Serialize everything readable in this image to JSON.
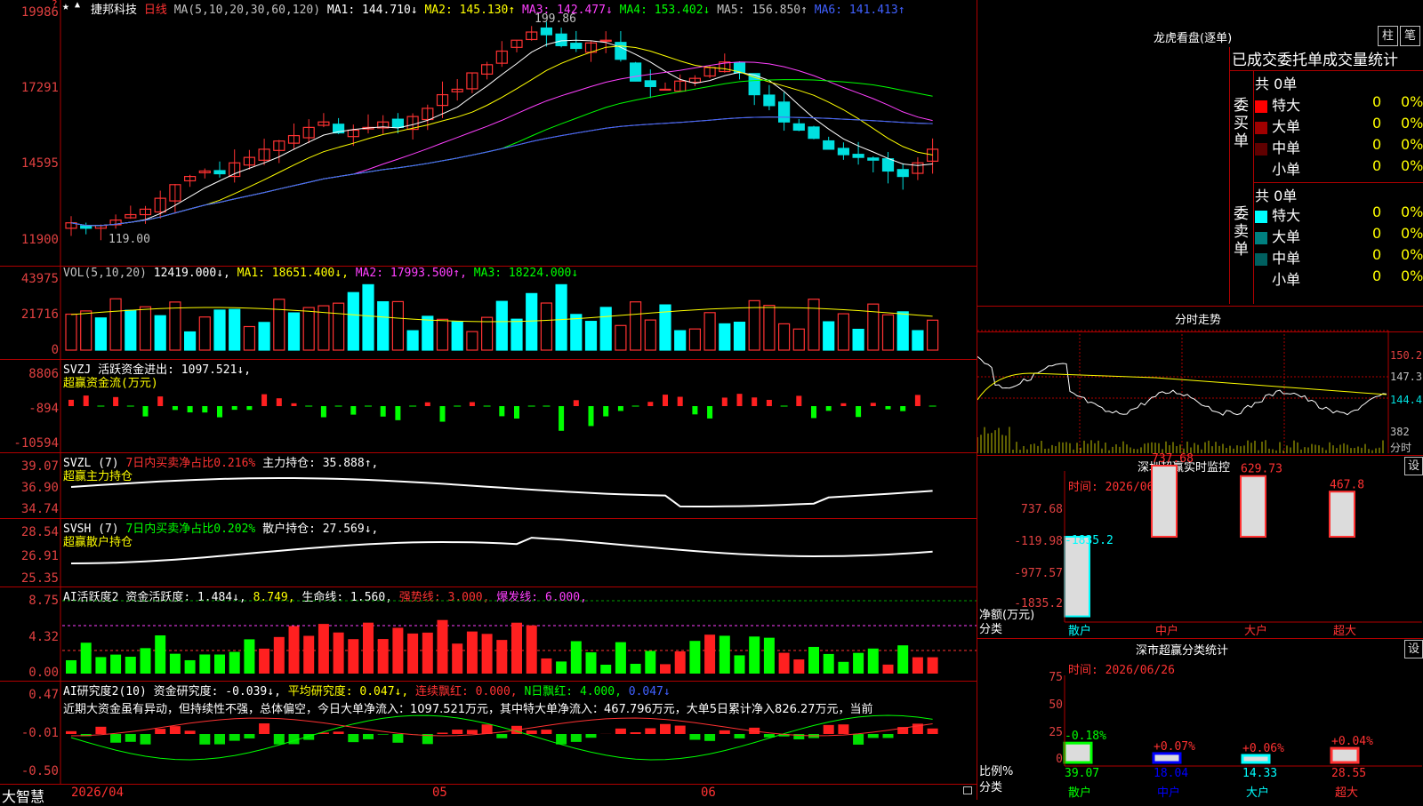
{
  "main": {
    "star_icon": "star-icon",
    "stock_name": "捷邦科技",
    "period": "日线",
    "ma_header": "MA(5,10,20,30,60,120)",
    "ma": [
      {
        "label": "MA1:",
        "value": "144.710",
        "dir": "↓",
        "color": "#ffffff"
      },
      {
        "label": "MA2:",
        "value": "145.130",
        "dir": "↑",
        "color": "#ffff00"
      },
      {
        "label": "MA3:",
        "value": "142.477",
        "dir": "↓",
        "color": "#ff40ff"
      },
      {
        "label": "MA4:",
        "value": "153.402",
        "dir": "↓",
        "color": "#00ff00"
      },
      {
        "label": "MA5:",
        "value": "156.850",
        "dir": "↑",
        "color": "#c0c0c0"
      },
      {
        "label": "MA6:",
        "value": "141.413",
        "dir": "↑",
        "color": "#4060ff"
      }
    ],
    "y_ticks": [
      "19986",
      "17291",
      "14595",
      "11900"
    ],
    "high_label": "199.86",
    "low_label": "119.00"
  },
  "vol": {
    "header": "VOL(5,10,20)",
    "value": "12419.000↓,",
    "ma1": "MA1: 18651.400↓,",
    "ma2": "MA2: 17993.500↑,",
    "ma3": "MA3: 18224.000↓",
    "y_ticks": [
      "43975",
      "21716",
      "0"
    ]
  },
  "svzj": {
    "header": "SVZJ  活跃资金进出: 1097.521↓,",
    "sub": "超赢资金流(万元)",
    "y_ticks": [
      "8806",
      "-894",
      "-10594"
    ]
  },
  "svzl": {
    "header": "SVZL (7)",
    "net": "7日内买卖净占比0.216%",
    "hold": "主力持仓: 35.888↑,",
    "sub": "超赢主力持仓",
    "y_ticks": [
      "39.07",
      "36.90",
      "34.74"
    ]
  },
  "svsh": {
    "header": "SVSH (7)",
    "net": "7日内买卖净占比0.202%",
    "hold": "散户持仓: 27.569↓,",
    "sub": "超赢散户持仓",
    "y_ticks": [
      "28.54",
      "26.91",
      "25.35"
    ]
  },
  "ai1": {
    "header": "AI活跃度2",
    "a": "资金活跃度: 1.484↓,",
    "b": "8.749,",
    "c": "生命线: 1.560,",
    "d": "强势线: 3.000,",
    "e": "爆发线: 6.000,",
    "y_ticks": [
      "8.75",
      "4.32",
      "0.00"
    ]
  },
  "ai2": {
    "header": "AI研究度2(10)",
    "a": "资金研究度: -0.039↓,",
    "b": "平均研究度: 0.047↓,",
    "c": "连续飘红: 0.000,",
    "d": "N日飘红: 4.000,",
    "e": "0.047↓",
    "commentary": "近期大资金虽有异动，但持续性不强，总体偏空，今日大单净流入：1097.521万元，其中特大单净流入：467.796万元，大单5日累计净入826.27万元，当前",
    "y_ticks": [
      "0.47",
      "-0.01",
      "-0.50"
    ]
  },
  "footer": {
    "brand": "大智慧",
    "date1": "2026/04",
    "date2": "05",
    "date3": "06"
  },
  "right": {
    "dragon_title": "龙虎看盘(逐单)",
    "btn_zhu": "柱",
    "btn_bi": "笔",
    "stat_title": "已成交委托单成交量统计",
    "buy_label": "委买单",
    "sell_label": "委卖单",
    "buy_total": "共 0单",
    "sell_total": "共 0单",
    "buy_rows": [
      {
        "name": "特大",
        "vol": "0",
        "pct": "0%",
        "color": "#ff0000"
      },
      {
        "name": "大单",
        "vol": "0",
        "pct": "0%",
        "color": "#a00000"
      },
      {
        "name": "中单",
        "vol": "0",
        "pct": "0%",
        "color": "#600000"
      },
      {
        "name": "小单",
        "vol": "0",
        "pct": "0%",
        "color": "#000000"
      }
    ],
    "sell_rows": [
      {
        "name": "特大",
        "vol": "0",
        "pct": "0%",
        "color": "#00ffff"
      },
      {
        "name": "大单",
        "vol": "0",
        "pct": "0%",
        "color": "#008080"
      },
      {
        "name": "中单",
        "vol": "0",
        "pct": "0%",
        "color": "#006060"
      },
      {
        "name": "小单",
        "vol": "0",
        "pct": "0%",
        "color": "#000000"
      }
    ],
    "intraday_title": "分时走势",
    "intraday_y": [
      "150.2",
      "147.3",
      "144.4"
    ],
    "intraday_vol": "382",
    "intraday_label": "分时",
    "sz_title": "深圳超赢实时监控",
    "sz_btn": "设",
    "sz_time": "时间: 2026/06/26",
    "sz_y": [
      "737.68",
      "-119.98",
      "-977.57",
      "-1835.2"
    ],
    "sz_ylabel": "净额(万元)",
    "sz_xlabel": "分类",
    "sz_bars": [
      {
        "label": "散户",
        "value": "-1835.2"
      },
      {
        "label": "中户",
        "value": "737.68"
      },
      {
        "label": "大户",
        "value": "629.73"
      },
      {
        "label": "超大",
        "value": "467.8"
      }
    ],
    "cls_title": "深市超赢分类统计",
    "cls_btn": "设",
    "cls_time": "时间: 2026/06/26",
    "cls_y": [
      "75",
      "50",
      "25",
      "0"
    ],
    "cls_ylabel": "比例%",
    "cls_xlabel": "分类",
    "cls_bars": [
      {
        "label": "散户",
        "value": "39.07",
        "delta": "-0.18%"
      },
      {
        "label": "中户",
        "value": "18.04",
        "delta": "+0.07%"
      },
      {
        "label": "大户",
        "value": "14.33",
        "delta": "+0.06%"
      },
      {
        "label": "超大",
        "value": "28.55",
        "delta": "+0.04%"
      }
    ]
  }
}
